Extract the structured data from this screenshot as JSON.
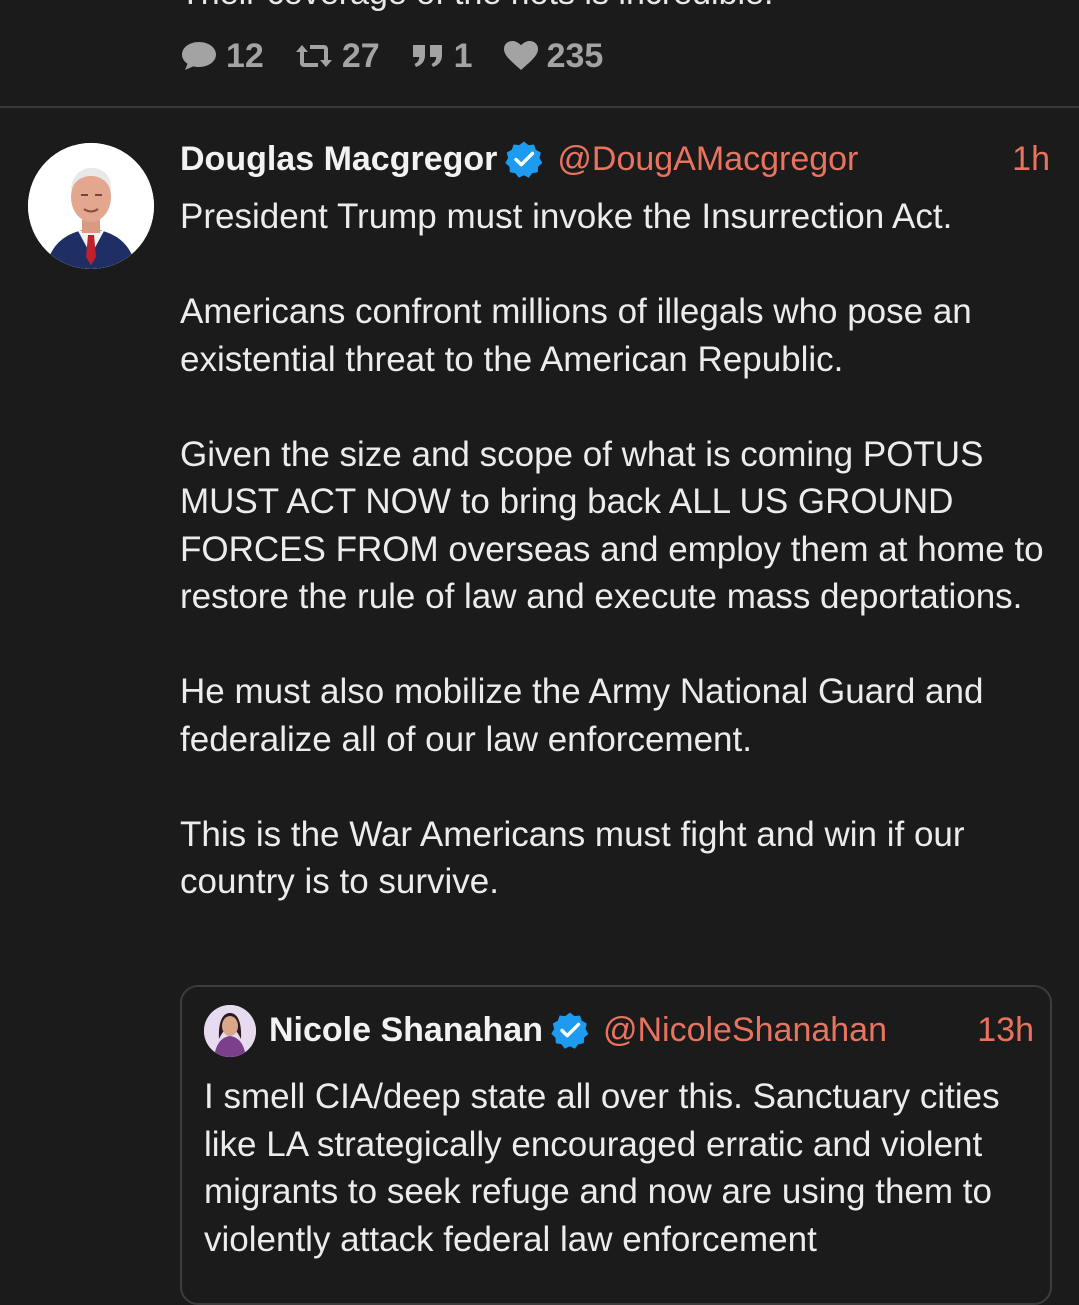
{
  "previous_post": {
    "text_partial": "Their coverage of the riots is incredible.",
    "stats": {
      "replies": "12",
      "reposts": "27",
      "quotes": "1",
      "likes": "235"
    },
    "icons": [
      "comment-icon",
      "repost-icon",
      "quote-icon",
      "heart-icon"
    ]
  },
  "post": {
    "author": "Douglas Macgregor",
    "handle": "@DougAMacgregor",
    "time": "1h",
    "verified": true,
    "paragraphs": [
      "President Trump must invoke the Insurrection Act.",
      "Americans confront millions of illegals who pose an existential threat to the American Republic.",
      "Given the size and scope of what is coming POTUS MUST ACT NOW to bring back ALL US GROUND FORCES FROM overseas and employ them at home to restore the rule of law and execute mass deportations.",
      "He must also mobilize the Army National Guard and federalize all of our law enforcement.",
      "This is the War Americans must fight and win if our country is to survive."
    ]
  },
  "quoted_post": {
    "author": "Nicole Shanahan",
    "handle": "@NicoleShanahan",
    "time": "13h",
    "verified": true,
    "text": "I smell CIA/deep state all over this. Sanctuary cities like LA strategically encouraged erratic and violent migrants to seek refuge and now are using them to violently attack federal law enforcement"
  },
  "colors": {
    "background": "#1b1b1b",
    "accent": "#e9735e",
    "verified_badge": "#1d9bf0",
    "muted": "#a3a3a3",
    "divider": "#3a3a3a"
  }
}
